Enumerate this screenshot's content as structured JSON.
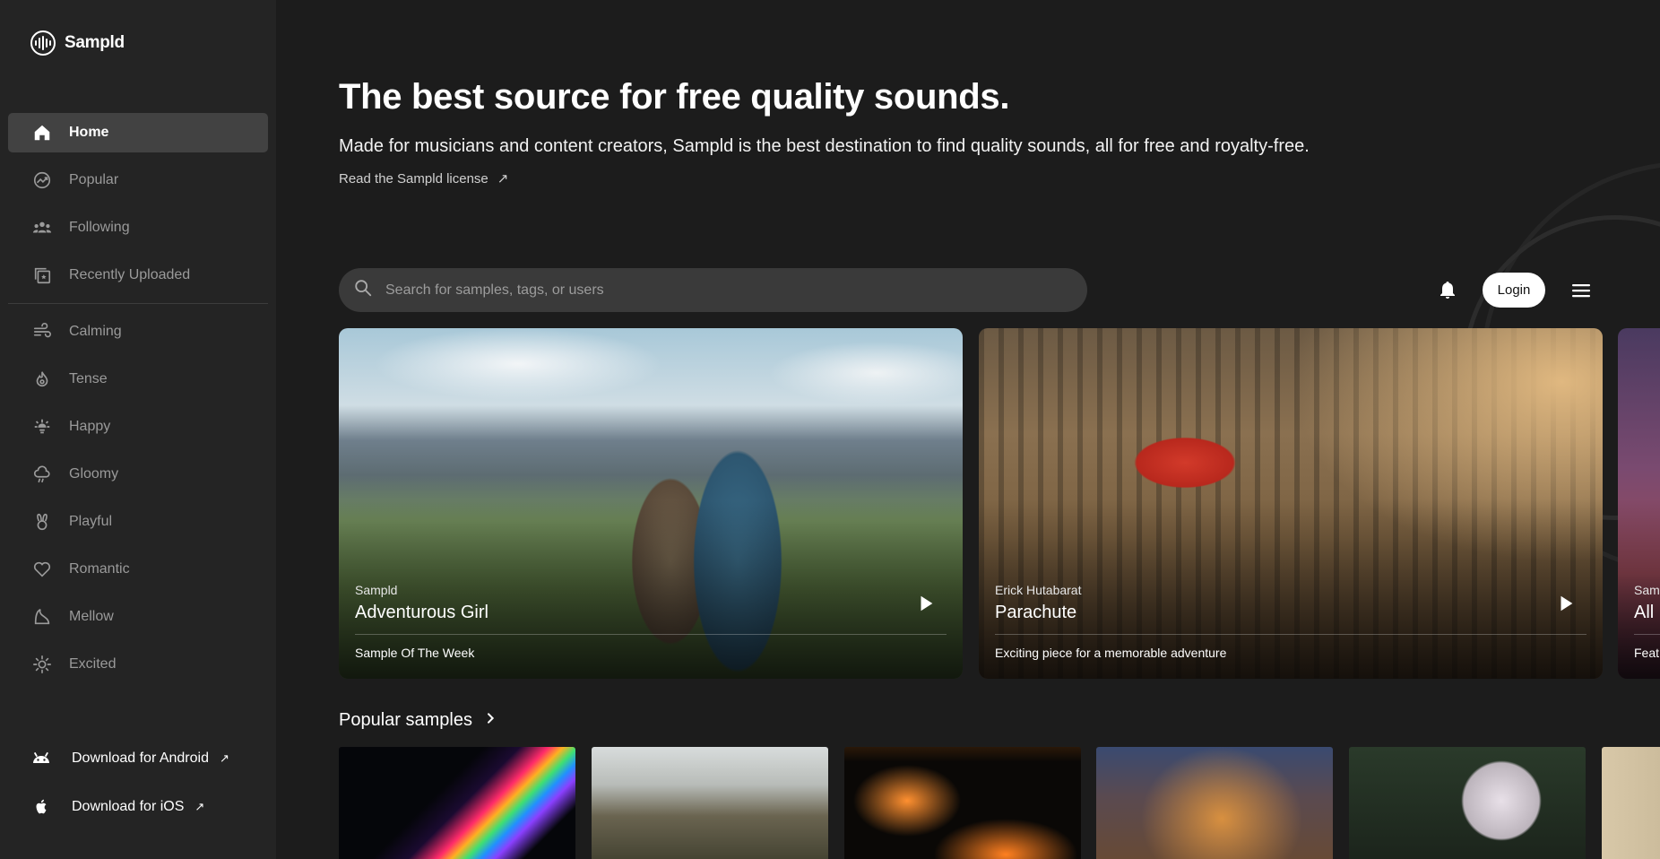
{
  "brand": {
    "name": "Sampld"
  },
  "sidebar": {
    "primary": [
      {
        "label": "Home",
        "icon": "home-icon",
        "active": true
      },
      {
        "label": "Popular",
        "icon": "trending-icon"
      },
      {
        "label": "Following",
        "icon": "people-icon"
      },
      {
        "label": "Recently Uploaded",
        "icon": "recent-upload-icon"
      }
    ],
    "moods": [
      {
        "label": "Calming",
        "icon": "wind-icon"
      },
      {
        "label": "Tense",
        "icon": "flame-icon"
      },
      {
        "label": "Happy",
        "icon": "sunrise-icon"
      },
      {
        "label": "Gloomy",
        "icon": "rain-cloud-icon"
      },
      {
        "label": "Playful",
        "icon": "bunny-icon"
      },
      {
        "label": "Romantic",
        "icon": "heart-icon"
      },
      {
        "label": "Mellow",
        "icon": "moon-icon"
      },
      {
        "label": "Excited",
        "icon": "sun-icon"
      }
    ],
    "downloads": [
      {
        "label": "Download for Android",
        "icon": "android-icon"
      },
      {
        "label": "Download for iOS",
        "icon": "apple-icon"
      }
    ]
  },
  "hero": {
    "title": "The best source for free quality sounds.",
    "subtitle": "Made for musicians and content creators, Sampld is the best destination to find quality sounds, all for free and royalty-free.",
    "license_link": "Read the Sampld license"
  },
  "search": {
    "placeholder": "Search for samples, tags, or users"
  },
  "header": {
    "login_label": "Login"
  },
  "featured": [
    {
      "author": "Sampld",
      "title": "Adventurous Girl",
      "description": "Sample Of The Week"
    },
    {
      "author": "Erick Hutabarat",
      "title": "Parachute",
      "description": "Exciting piece for a memorable adventure"
    },
    {
      "author": "Sam",
      "title": "All I",
      "description": "Feat"
    }
  ],
  "popular": {
    "title": "Popular samples"
  },
  "colors": {
    "background": "#1c1c1c",
    "sidebar": "#242424",
    "active": "#424242",
    "search": "#3a3a3a"
  }
}
